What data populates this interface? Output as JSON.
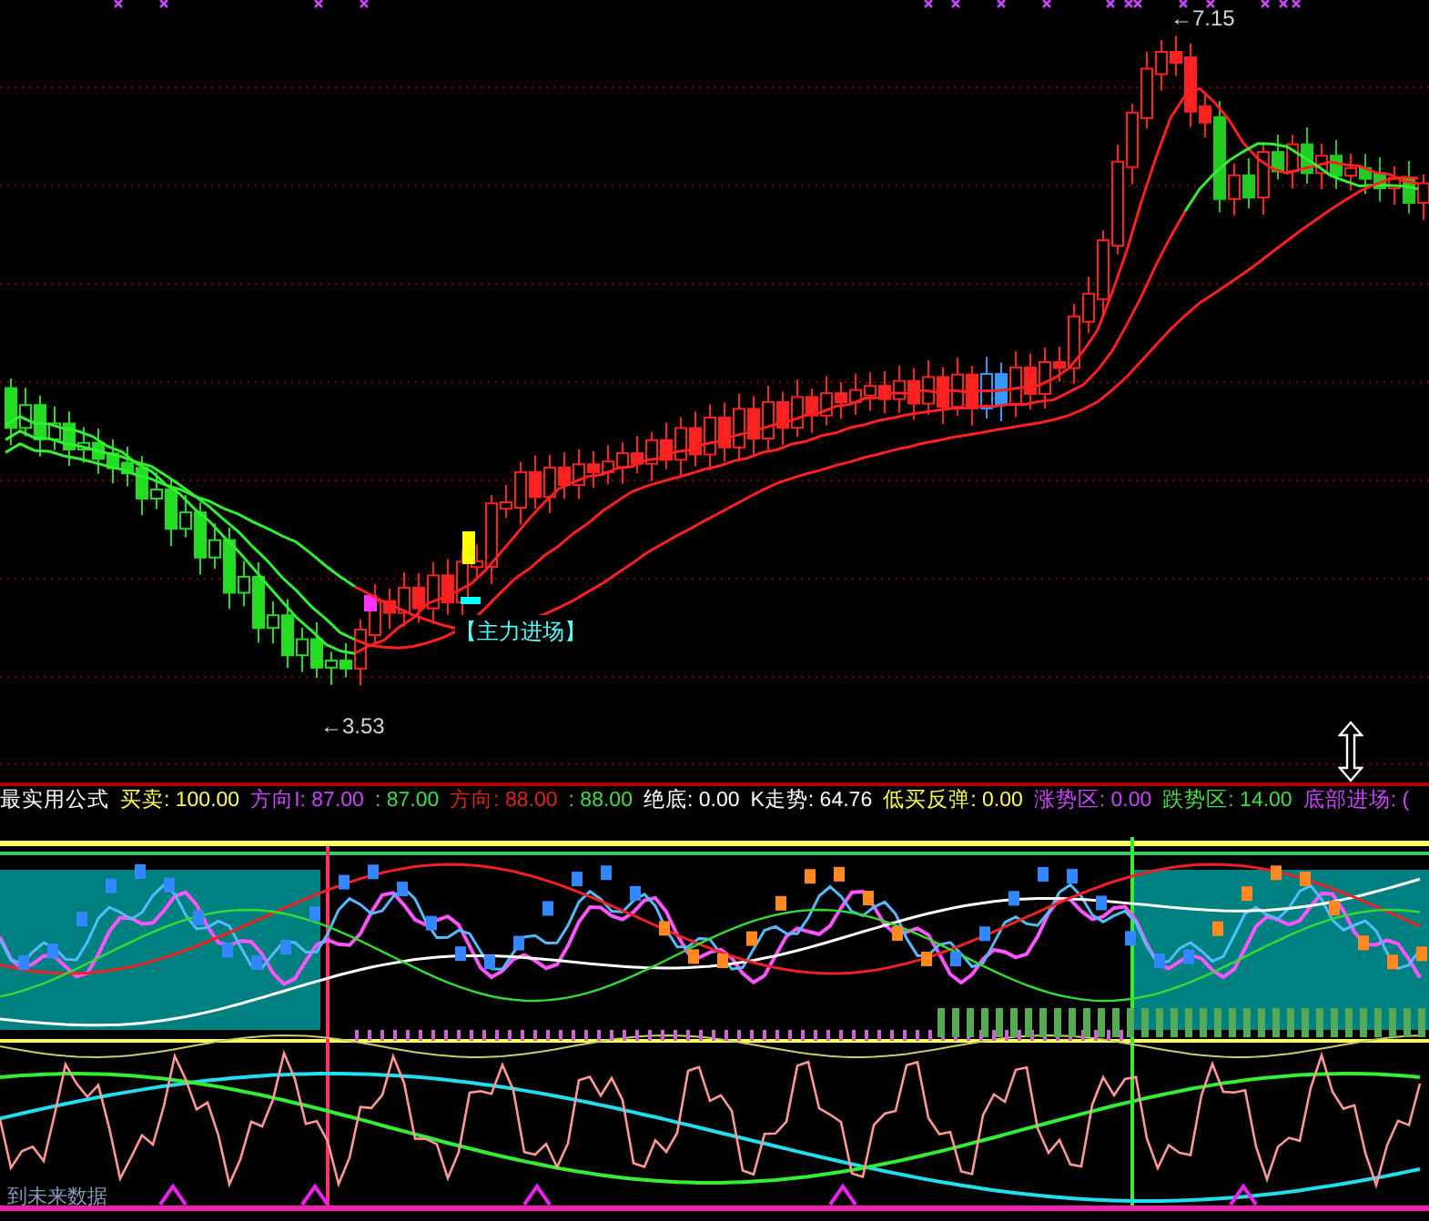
{
  "main_chart": {
    "high_label": "←7.15",
    "low_label": "←3.53",
    "signal_label": "【主力进场】"
  },
  "indicator": {
    "title": "最实用公式",
    "readings": [
      {
        "text": "买卖: 100.00",
        "color": "#ffff55"
      },
      {
        "text": "方向I: 87.00",
        "color": "#cc44ff"
      },
      {
        "text": ": 87.00",
        "color": "#44dd44"
      },
      {
        "text": "方向: 88.00",
        "color": "#dd2222"
      },
      {
        "text": ": 88.00",
        "color": "#44dd44"
      },
      {
        "text": "绝底: 0.00",
        "color": "#ffffff"
      },
      {
        "text": "K走势: 64.76",
        "color": "#ffffff"
      },
      {
        "text": "低买反弹: 0.00",
        "color": "#ffff55"
      },
      {
        "text": "涨势区: 0.00",
        "color": "#cc44ff"
      },
      {
        "text": "跌势区: 14.00",
        "color": "#44dd44"
      },
      {
        "text": "底部进场: (",
        "color": "#cc44ff"
      }
    ]
  },
  "footer_note": "到未来数据"
}
